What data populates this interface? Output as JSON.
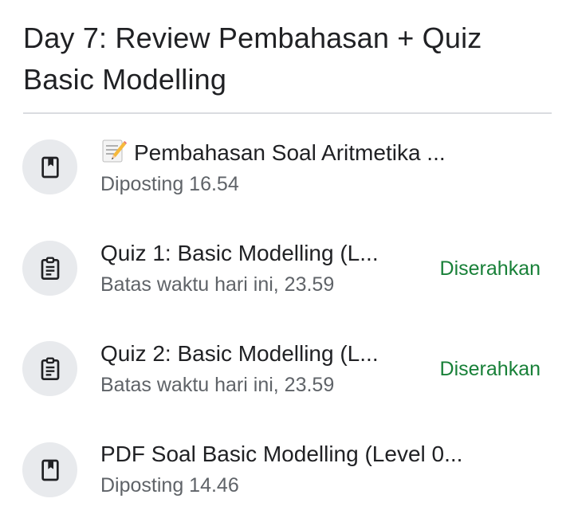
{
  "topic": {
    "title": "Day 7: Review Pembahasan + Quiz Basic Modelling"
  },
  "items": [
    {
      "icon": "material-icon",
      "title": "Pembahasan Soal Aritmetika ...",
      "title_icon": "memo-emoji-icon",
      "subtitle": "Diposting 16.54",
      "status": ""
    },
    {
      "icon": "assignment-icon",
      "title": "Quiz 1: Basic Modelling (L...",
      "subtitle": "Batas waktu hari ini, 23.59",
      "status": "Diserahkan"
    },
    {
      "icon": "assignment-icon",
      "title": "Quiz 2: Basic Modelling (L...",
      "subtitle": "Batas waktu hari ini, 23.59",
      "status": "Diserahkan"
    },
    {
      "icon": "material-icon",
      "title": "PDF Soal Basic Modelling (Level 0...",
      "subtitle": "Diposting 14.46",
      "status": ""
    }
  ],
  "colors": {
    "status_green": "#188038",
    "icon_bg": "#e8eaed",
    "text_primary": "#202124",
    "text_secondary": "#5f6368"
  }
}
